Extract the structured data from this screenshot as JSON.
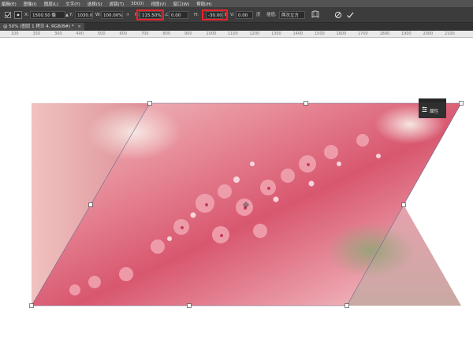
{
  "menu": [
    "編輯(E)",
    "图像(I)",
    "图层(L)",
    "文字(Y)",
    "选择(S)",
    "滤镜(T)",
    "3D(D)",
    "视图(V)",
    "窗口(W)",
    "帮助(H)"
  ],
  "options": {
    "x_label": "X:",
    "x_value": "1500.50 像",
    "y_label": "Y:",
    "y_value": "1030.00 像",
    "w_label": "W:",
    "w_value": "100.00%",
    "h_label": "H:",
    "h_value": "115.50%",
    "angle_value": "0.00",
    "hskew_value": "-30.00",
    "vskew_label": "V:",
    "vskew_value": "0.00",
    "interp_label": "插值:",
    "interp_value": "两次立方"
  },
  "document_tab": "@ 50% (图层 1 拷贝 4, RGB/8#) *",
  "ruler_ticks": [
    "100",
    "150",
    "300",
    "400",
    "500",
    "600",
    "700",
    "800",
    "900",
    "1000",
    "1100",
    "1200",
    "1300",
    "1400",
    "1500",
    "1600",
    "1700",
    "1800",
    "1900",
    "2000",
    "2100"
  ],
  "panel_label": "属性",
  "colors": {
    "menubar": "#535353",
    "optionsbar": "#3c3c3c",
    "highlight": "#e8232a",
    "canvas": "#ffffff"
  }
}
